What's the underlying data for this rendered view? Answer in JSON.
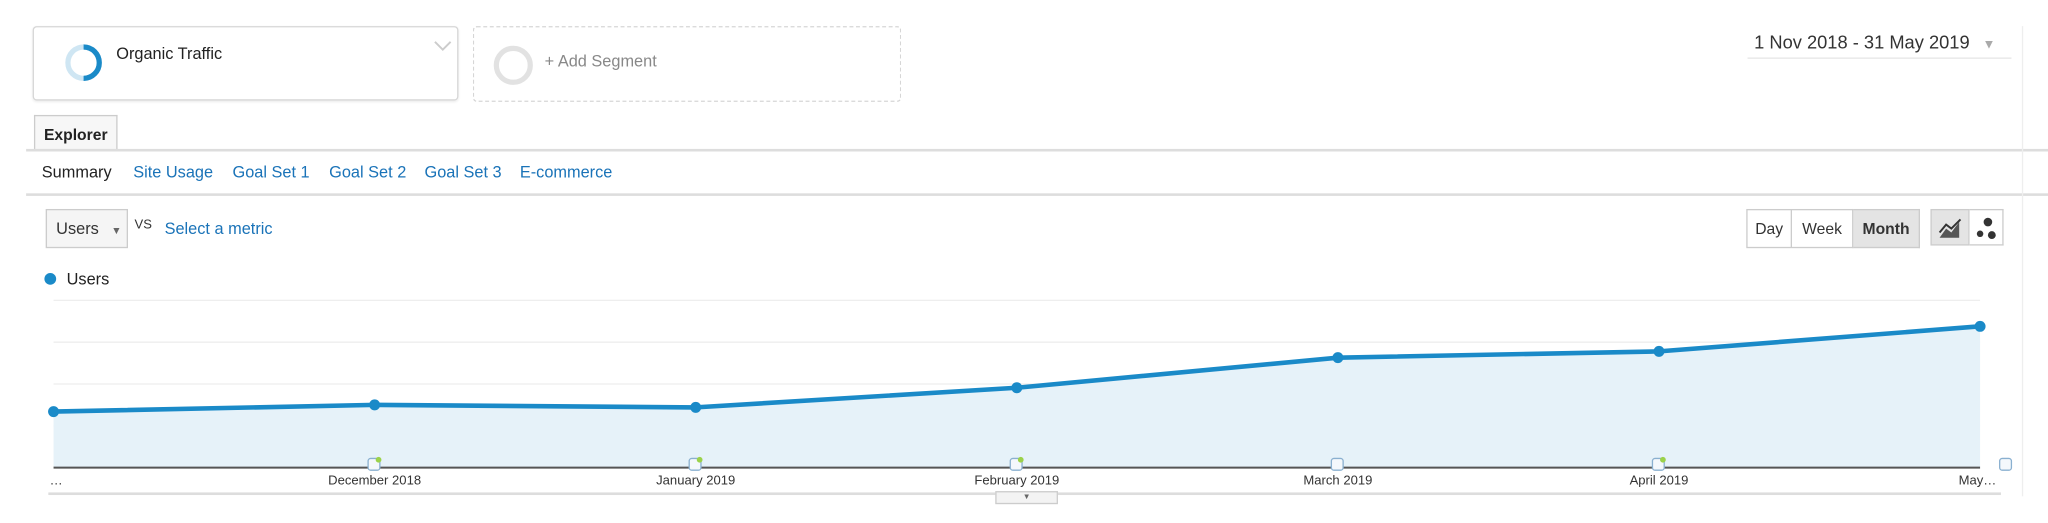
{
  "segments": {
    "active": {
      "label": "Organic Traffic",
      "color": "#1a8ac8"
    },
    "add_label": "+ Add Segment"
  },
  "date_range": {
    "label": "1 Nov 2018 - 31 May 2019"
  },
  "tabs": [
    {
      "label": "Explorer",
      "active": true
    }
  ],
  "subnav": {
    "items": [
      {
        "label": "Summary",
        "active": true
      },
      {
        "label": "Site Usage"
      },
      {
        "label": "Goal Set 1"
      },
      {
        "label": "Goal Set 2"
      },
      {
        "label": "Goal Set 3"
      },
      {
        "label": "E-commerce"
      }
    ]
  },
  "controls": {
    "metric": "Users",
    "vs": "VS",
    "select_metric": "Select a metric",
    "granularity": [
      {
        "label": "Day"
      },
      {
        "label": "Week"
      },
      {
        "label": "Month",
        "active": true
      }
    ],
    "chart_modes": [
      {
        "icon": "line-chart-icon",
        "active": true
      },
      {
        "icon": "motion-chart-icon"
      }
    ]
  },
  "chart_data": {
    "type": "area",
    "legend": [
      {
        "name": "Users",
        "color": "#1a8ac8"
      }
    ],
    "categories": [
      "…",
      "December 2018",
      "January 2019",
      "February 2019",
      "March 2019",
      "April 2019",
      "May…"
    ],
    "series": [
      {
        "name": "Users",
        "values": [
          1.34,
          1.5,
          1.44,
          1.91,
          2.63,
          2.78,
          3.38
        ]
      }
    ],
    "ylim": [
      0,
      4
    ],
    "y_gridlines": 4,
    "grid": true,
    "legend_position": "top-left",
    "annotations": [
      "December 2018",
      "January 2019",
      "February 2019",
      "March 2019",
      "April 2019",
      "May…"
    ]
  }
}
